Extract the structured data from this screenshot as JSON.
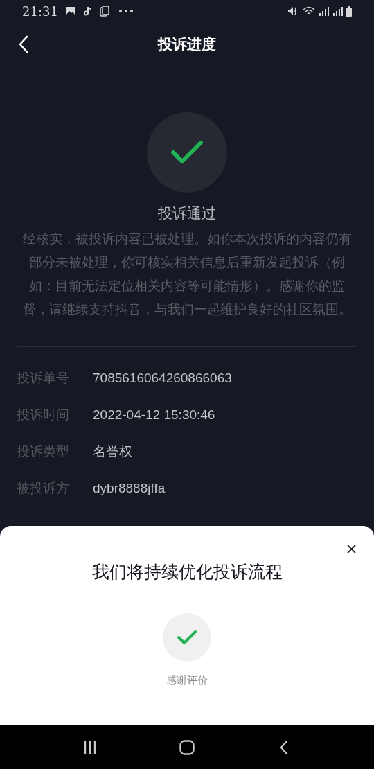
{
  "status_bar": {
    "time": "21:31"
  },
  "header": {
    "title": "投诉进度"
  },
  "result": {
    "title": "投诉通过",
    "message": "经核实，被投诉内容已被处理。如你本次投诉的内容仍有部分未被处理，你可核实相关信息后重新发起投诉（例如：目前无法定位相关内容等可能情形）。感谢你的监督，请继续支持抖音，与我们一起维护良好的社区氛围。"
  },
  "details": [
    {
      "label": "投诉单号",
      "value": "7085616064260866063"
    },
    {
      "label": "投诉时间",
      "value": "2022-04-12 15:30:46"
    },
    {
      "label": "投诉类型",
      "value": "名誉权"
    },
    {
      "label": "被投诉方",
      "value": "dybr8888jffa"
    }
  ],
  "sheet": {
    "title": "我们将持续优化投诉流程",
    "caption": "感谢评价"
  }
}
